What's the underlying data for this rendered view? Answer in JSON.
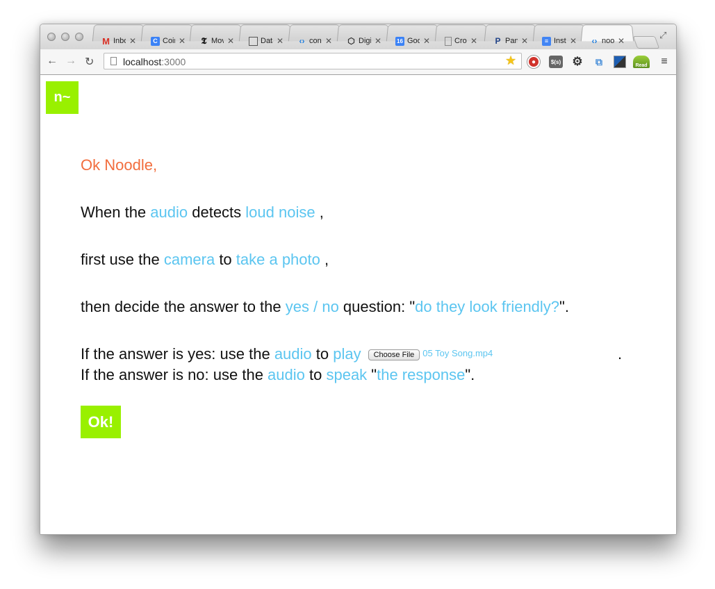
{
  "browser": {
    "tabs": [
      {
        "title": "Inbox",
        "favicon": "gmail-icon",
        "color": "#d93025"
      },
      {
        "title": "Coin",
        "favicon": "c-icon",
        "color": "#3b82f6"
      },
      {
        "title": "Movies",
        "favicon": "nyt-icon",
        "color": "#111111"
      },
      {
        "title": "Data",
        "favicon": "data-icon",
        "color": "#555555"
      },
      {
        "title": "con",
        "favicon": "code-icon",
        "color": "#1f7fe0"
      },
      {
        "title": "Digi",
        "favicon": "cube-icon",
        "color": "#333333"
      },
      {
        "title": "Goo",
        "favicon": "calendar-icon",
        "color": "#3b82f6"
      },
      {
        "title": "Cro",
        "favicon": "page-icon",
        "color": "#888888"
      },
      {
        "title": "Pan",
        "favicon": "p-icon",
        "color": "#224488"
      },
      {
        "title": "Inst",
        "favicon": "docs-icon",
        "color": "#4285f4"
      },
      {
        "title": "noo",
        "favicon": "code-icon",
        "color": "#1f7fe0",
        "active": true
      }
    ],
    "url_host": "localhost",
    "url_port": ":3000",
    "ext_label_dollar": "$(s)",
    "ext_label_read": "Read"
  },
  "page": {
    "logo": "n~",
    "greeting": "Ok Noodle,",
    "line1": {
      "p1": "When the ",
      "k1": "audio",
      "p2": " detects ",
      "k2": "loud noise",
      "p3": " ,"
    },
    "line2": {
      "p1": "first use the ",
      "k1": "camera",
      "p2": " to ",
      "k2": "take a photo",
      "p3": " ,"
    },
    "line3": {
      "p1": "then decide the answer to the ",
      "k1": "yes / no",
      "p2": " question: \"",
      "k2": "do they look friendly?",
      "p3": "\"."
    },
    "line4": {
      "p1": "If the answer is yes: use the ",
      "k1": "audio",
      "p2": " to ",
      "k2": "play",
      "file_button": "Choose File",
      "file_name": "05 Toy Song.mp4",
      "end": "."
    },
    "line5": {
      "p1": "If the answer is no: use the ",
      "k1": "audio",
      "p2": " to ",
      "k2": "speak",
      "p3": " \"",
      "k3": "the response",
      "p4": "\"."
    },
    "ok_button": "Ok!"
  },
  "colors": {
    "accent_green": "#99f000",
    "keyword_blue": "#5bc5f0",
    "greeting_orange": "#f26d3d"
  }
}
